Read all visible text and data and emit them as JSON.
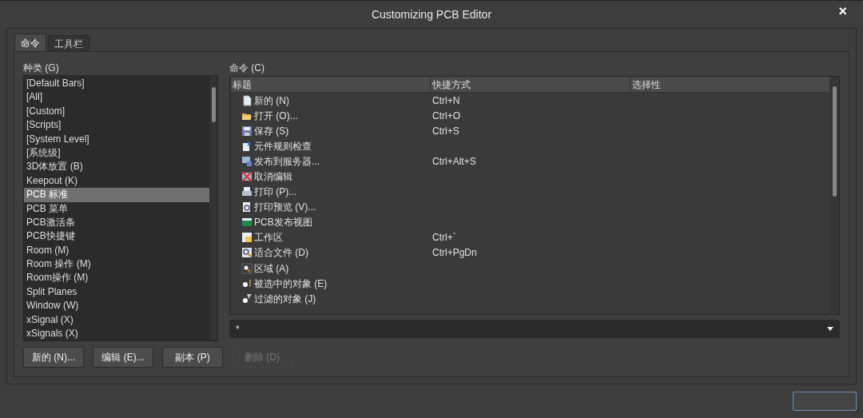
{
  "window": {
    "title": "Customizing PCB Editor",
    "close": "×"
  },
  "tabs": [
    {
      "label": "命令",
      "selected": true
    },
    {
      "label": "工具栏",
      "selected": false
    }
  ],
  "categories": {
    "label": "种类 (G)",
    "items": [
      {
        "label": "[Default Bars]",
        "selected": false
      },
      {
        "label": "[All]",
        "selected": false
      },
      {
        "label": "[Custom]",
        "selected": false
      },
      {
        "label": "[Scripts]",
        "selected": false
      },
      {
        "label": "[System Level]",
        "selected": false
      },
      {
        "label": "[系统级]",
        "selected": false
      },
      {
        "label": "3D体放置 (B)",
        "selected": false
      },
      {
        "label": "Keepout (K)",
        "selected": false
      },
      {
        "label": "PCB 标准",
        "selected": true
      },
      {
        "label": "PCB 菜单",
        "selected": false
      },
      {
        "label": "PCB激活条",
        "selected": false
      },
      {
        "label": "PCB快捷键",
        "selected": false
      },
      {
        "label": "Room (M)",
        "selected": false
      },
      {
        "label": "Room 操作 (M)",
        "selected": false
      },
      {
        "label": "Room操作 (M)",
        "selected": false
      },
      {
        "label": "Split Planes",
        "selected": false
      },
      {
        "label": "Window (W)",
        "selected": false
      },
      {
        "label": "xSignal (X)",
        "selected": false
      },
      {
        "label": "xSignals (X)",
        "selected": false
      }
    ]
  },
  "commands": {
    "label": "命令 (C)",
    "columns": [
      "标题",
      "快捷方式",
      "选择性"
    ],
    "rows": [
      {
        "title": "新的 (N)",
        "shortcut": "Ctrl+N"
      },
      {
        "title": "打开 (O)...",
        "shortcut": "Ctrl+O"
      },
      {
        "title": "保存 (S)",
        "shortcut": "Ctrl+S"
      },
      {
        "title": "元件规则检查"
      },
      {
        "title": "发布到服务器...",
        "shortcut": "Ctrl+Alt+S"
      },
      {
        "title": "取消编辑"
      },
      {
        "title": "打印 (P)..."
      },
      {
        "title": "打印预览 (V)..."
      },
      {
        "title": "PCB发布视图"
      },
      {
        "title": "工作区",
        "shortcut": "Ctrl+`"
      },
      {
        "title": "适合文件 (D)",
        "shortcut": "Ctrl+PgDn"
      },
      {
        "title": "区域 (A)"
      },
      {
        "title": "被选中的对象 (E)"
      },
      {
        "title": "过滤的对象 (J)"
      }
    ],
    "filter": "*"
  },
  "buttons": [
    {
      "label": "新的 (N)...",
      "disabled": false
    },
    {
      "label": "编辑 (E)...",
      "disabled": false
    },
    {
      "label": "副本 (P)",
      "disabled": false
    },
    {
      "label": "删除 (D)",
      "disabled": true
    }
  ]
}
